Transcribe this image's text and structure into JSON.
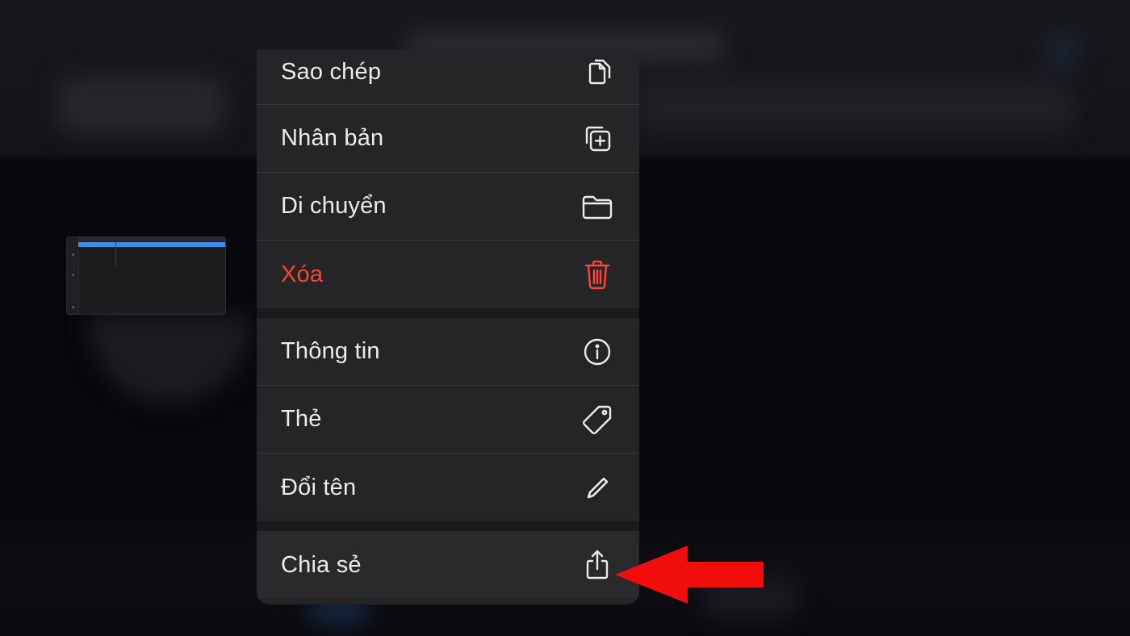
{
  "menu": {
    "items": [
      {
        "label": "Sao chép",
        "icon": "copy-icon"
      },
      {
        "label": "Nhân bản",
        "icon": "duplicate-icon"
      },
      {
        "label": "Di chuyển",
        "icon": "folder-icon"
      },
      {
        "label": "Xóa",
        "icon": "trash-icon",
        "destructive": true
      }
    ],
    "items2": [
      {
        "label": "Thông tin",
        "icon": "info-icon"
      },
      {
        "label": "Thẻ",
        "icon": "tag-icon"
      },
      {
        "label": "Đổi tên",
        "icon": "pencil-icon"
      }
    ],
    "share": {
      "label": "Chia sẻ",
      "icon": "share-icon"
    }
  },
  "colors": {
    "destructive": "#ff453a",
    "annotation_arrow": "#f20d0d",
    "selection": "#3a8ee6"
  }
}
